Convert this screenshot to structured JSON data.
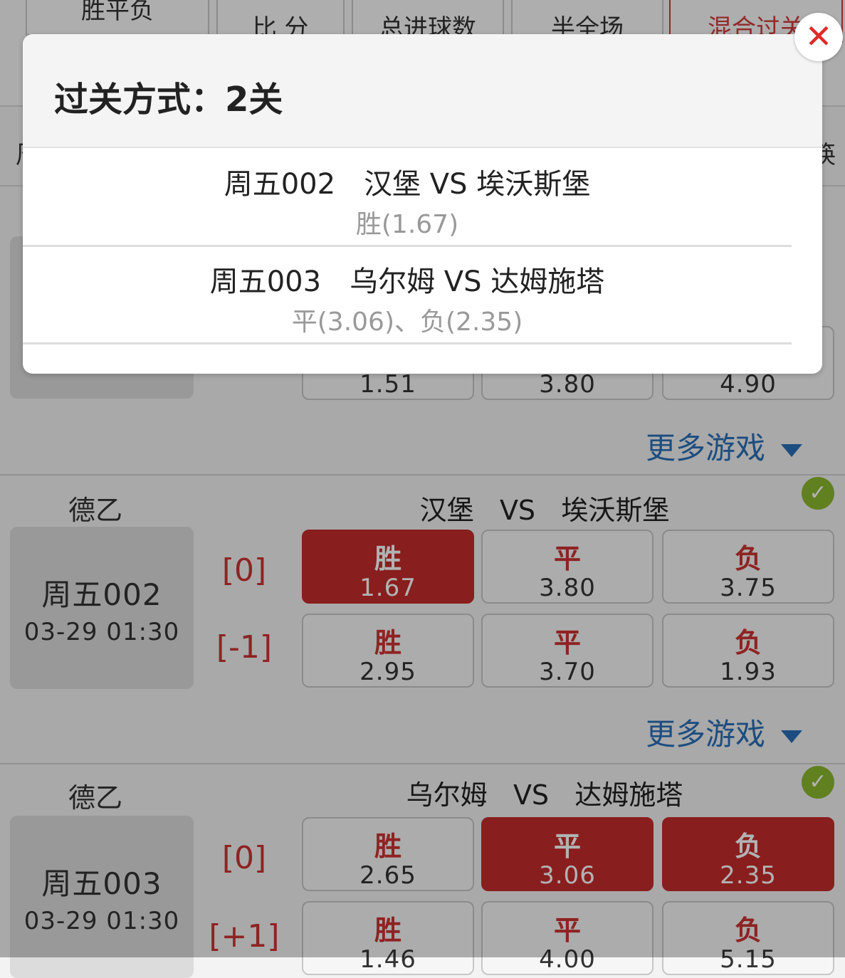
{
  "tabs": [
    "胜平负",
    "比 分",
    "总进球数",
    "半全场",
    "混合过关"
  ],
  "sub_stub_left": "周",
  "sub_stub_right": "筷",
  "first_match_odds": [
    "1.51",
    "3.80",
    "4.90"
  ],
  "more_label": "更多游戏",
  "matches": [
    {
      "league": "德乙",
      "home": "汉堡",
      "vs": "VS",
      "away": "埃沃斯堡",
      "num": "周五002",
      "time": "03-29 01:30",
      "handicaps": [
        "[0]",
        "[-1]"
      ],
      "rows": [
        [
          {
            "label": "胜",
            "odds": "1.67",
            "selected": true
          },
          {
            "label": "平",
            "odds": "3.80",
            "selected": false
          },
          {
            "label": "负",
            "odds": "3.75",
            "selected": false
          }
        ],
        [
          {
            "label": "胜",
            "odds": "2.95",
            "selected": false
          },
          {
            "label": "平",
            "odds": "3.70",
            "selected": false
          },
          {
            "label": "负",
            "odds": "1.93",
            "selected": false
          }
        ]
      ]
    },
    {
      "league": "德乙",
      "home": "乌尔姆",
      "vs": "VS",
      "away": "达姆施塔",
      "num": "周五003",
      "time": "03-29 01:30",
      "handicaps": [
        "[0]",
        "[+1]"
      ],
      "rows": [
        [
          {
            "label": "胜",
            "odds": "2.65",
            "selected": false
          },
          {
            "label": "平",
            "odds": "3.06",
            "selected": true
          },
          {
            "label": "负",
            "odds": "2.35",
            "selected": true
          }
        ],
        [
          {
            "label": "胜",
            "odds": "1.46",
            "selected": false
          },
          {
            "label": "平",
            "odds": "4.00",
            "selected": false
          },
          {
            "label": "负",
            "odds": "5.15",
            "selected": false
          }
        ]
      ]
    }
  ],
  "modal": {
    "title": "过关方式：2关",
    "picks": [
      {
        "header": "周五002　汉堡 VS 埃沃斯堡",
        "selection": "胜(1.67)"
      },
      {
        "header": "周五003　乌尔姆 VS 达姆施塔",
        "selection": "平(3.06)、负(2.35)"
      }
    ],
    "close_icon": "close-icon"
  },
  "colors": {
    "accent_red": "#c42c2c",
    "link_blue": "#2a6fb8",
    "check_green": "#8bb82e"
  }
}
